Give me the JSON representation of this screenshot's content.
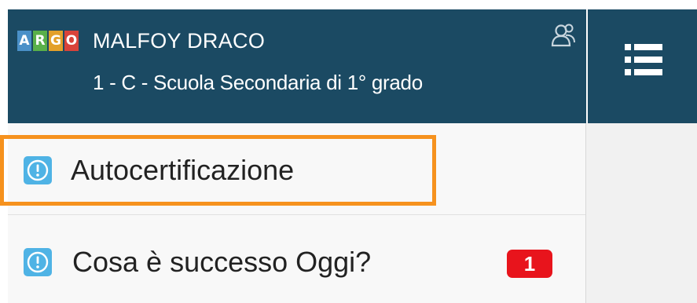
{
  "header": {
    "logo_letters": [
      "A",
      "R",
      "G",
      "O"
    ],
    "user_name": "MALFOY DRACO",
    "user_class": "1 - C - Scuola Secondaria di 1° grado",
    "user_switch_icon": "user-switch-icon",
    "menu_icon": "hamburger-list-icon"
  },
  "menu": {
    "items": [
      {
        "label": "Autocertificazione",
        "icon": "info-icon",
        "highlighted": true
      },
      {
        "label": "Cosa è successo Oggi?",
        "icon": "info-icon",
        "badge": "1"
      }
    ]
  },
  "colors": {
    "header_bg": "#1b4a63",
    "highlight_border": "#f6921e",
    "badge_bg": "#e8141c",
    "icon_bg": "#4fb3e5"
  }
}
